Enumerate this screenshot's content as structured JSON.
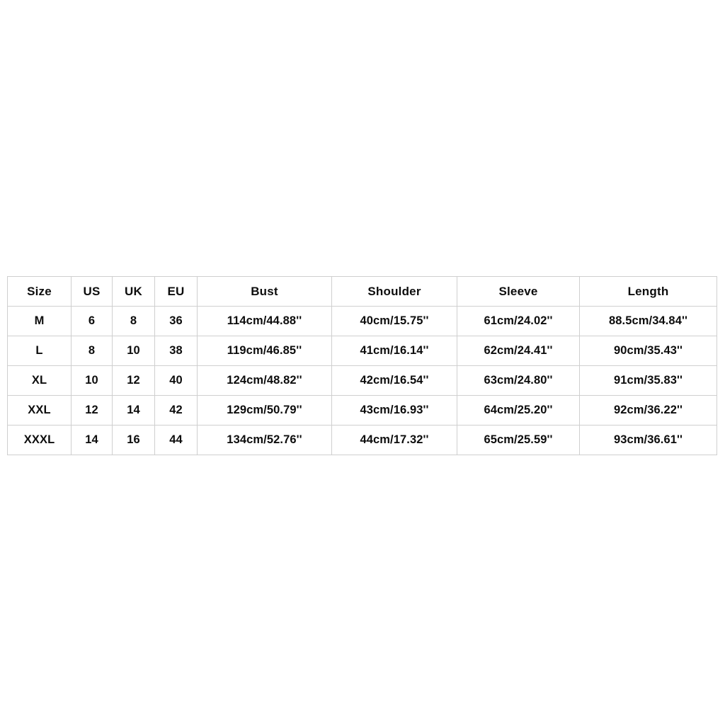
{
  "table": {
    "name": "apparel-size-chart",
    "columns": [
      {
        "key": "size",
        "label": "Size"
      },
      {
        "key": "us",
        "label": "US"
      },
      {
        "key": "uk",
        "label": "UK"
      },
      {
        "key": "eu",
        "label": "EU"
      },
      {
        "key": "bust",
        "label": "Bust"
      },
      {
        "key": "shoulder",
        "label": "Shoulder"
      },
      {
        "key": "sleeve",
        "label": "Sleeve"
      },
      {
        "key": "length",
        "label": "Length"
      }
    ],
    "rows": [
      {
        "size": "M",
        "us": "6",
        "uk": "8",
        "eu": "36",
        "bust": "114cm/44.88''",
        "shoulder": "40cm/15.75''",
        "sleeve": "61cm/24.02''",
        "length": "88.5cm/34.84''"
      },
      {
        "size": "L",
        "us": "8",
        "uk": "10",
        "eu": "38",
        "bust": "119cm/46.85''",
        "shoulder": "41cm/16.14''",
        "sleeve": "62cm/24.41''",
        "length": "90cm/35.43''"
      },
      {
        "size": "XL",
        "us": "10",
        "uk": "12",
        "eu": "40",
        "bust": "124cm/48.82''",
        "shoulder": "42cm/16.54''",
        "sleeve": "63cm/24.80''",
        "length": "91cm/35.83''"
      },
      {
        "size": "XXL",
        "us": "12",
        "uk": "14",
        "eu": "42",
        "bust": "129cm/50.79''",
        "shoulder": "43cm/16.93''",
        "sleeve": "64cm/25.20''",
        "length": "92cm/36.22''"
      },
      {
        "size": "XXXL",
        "us": "14",
        "uk": "16",
        "eu": "44",
        "bust": "134cm/52.76''",
        "shoulder": "44cm/17.32''",
        "sleeve": "65cm/25.59''",
        "length": "93cm/36.61''"
      }
    ]
  },
  "style": {
    "page_background": "#ffffff",
    "cell_background": "#ffffff",
    "text_color": "#0d0d0d",
    "inner_border_color": "#cfcfcf",
    "outer_border_color": "#9a9a9a"
  }
}
